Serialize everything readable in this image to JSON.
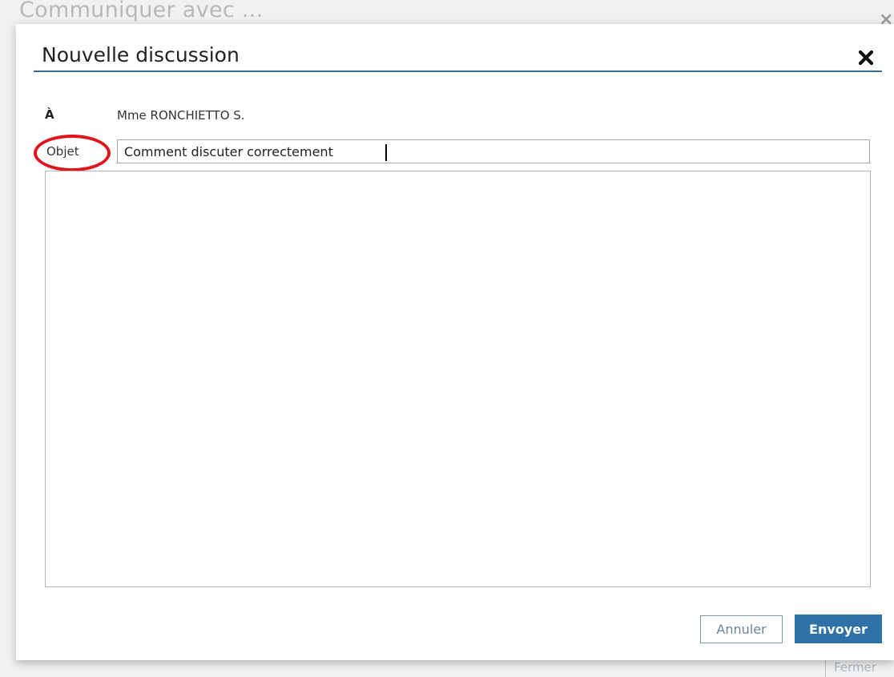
{
  "background_dialog": {
    "title": "Communiquer avec ...",
    "close_glyph": "×",
    "close_label": "Fermer"
  },
  "dialog": {
    "title": "Nouvelle discussion",
    "close_icon": "close-x-icon",
    "recipient": {
      "label": "À",
      "value": "Mme RONCHIETTO S."
    },
    "subject": {
      "label": "Objet",
      "value": "Comment discuter correctement"
    },
    "message": {
      "value": ""
    },
    "buttons": {
      "cancel_label": "Annuler",
      "send_label": "Envoyer"
    }
  },
  "colors": {
    "accent": "#2f72a8",
    "title_rule": "#3d6b8c",
    "annotation": "#e0141c"
  }
}
